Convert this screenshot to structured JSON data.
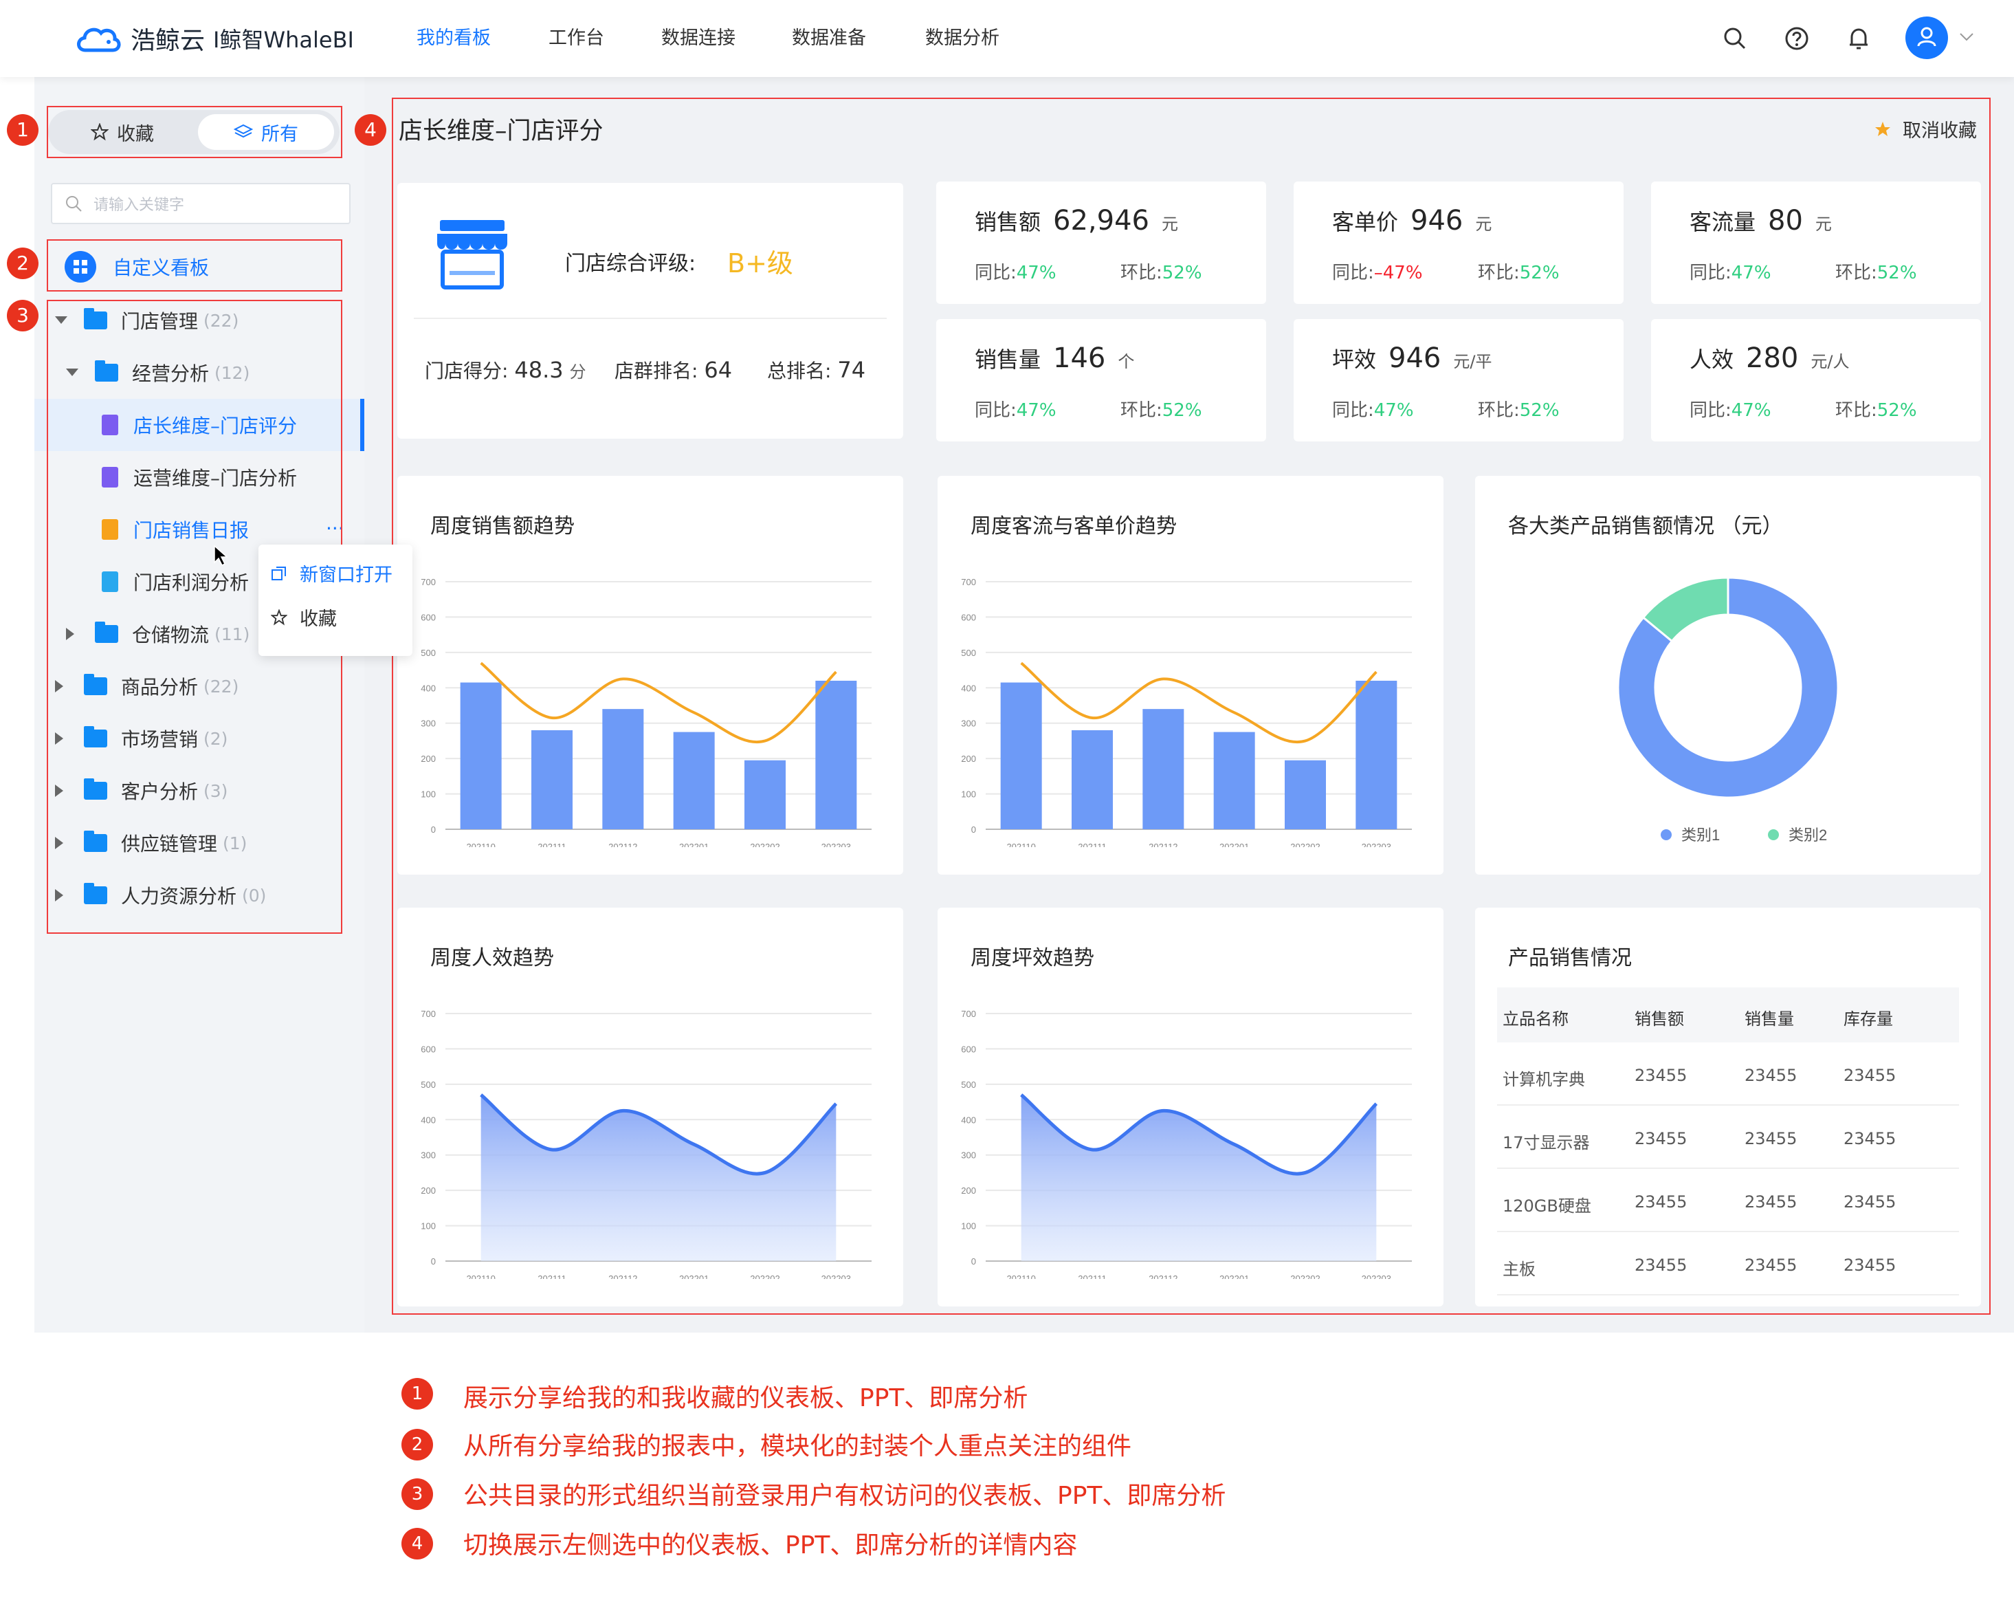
{
  "brand": {
    "name": "浩鲸云",
    "product": "I鲸智WhaleBI"
  },
  "nav": [
    "我的看板",
    "工作台",
    "数据连接",
    "数据准备",
    "数据分析"
  ],
  "sidebar": {
    "tabs": {
      "favorites": "收藏",
      "all": "所有"
    },
    "search_placeholder": "请输入关键字",
    "custom_board": "自定义看板",
    "tree": [
      {
        "label": "门店管理",
        "count": "(22)"
      },
      {
        "label": "经营分析",
        "count": "(12)"
      },
      {
        "label": "店长维度–门店评分"
      },
      {
        "label": "运营维度–门店分析"
      },
      {
        "label": "门店销售日报"
      },
      {
        "label": "门店利润分析"
      },
      {
        "label": "仓储物流",
        "count": "(11)"
      },
      {
        "label": "商品分析",
        "count": "(22)"
      },
      {
        "label": "市场营销",
        "count": "(2)"
      },
      {
        "label": "客户分析",
        "count": "(3)"
      },
      {
        "label": "供应链管理",
        "count": "(1)"
      },
      {
        "label": "人力资源分析",
        "count": "(0)"
      }
    ],
    "more": "···",
    "context_menu": [
      "新窗口打开",
      "收藏"
    ]
  },
  "main": {
    "title": "店长维度–门店评分",
    "unfavorite": "取消收藏",
    "store": {
      "rating_label": "门店综合评级:",
      "rating": "B+级",
      "score_label": "门店得分:",
      "score": "48.3",
      "score_unit": "分",
      "group_rank_label": "店群排名:",
      "group_rank": "64",
      "total_rank_label": "总排名:",
      "total_rank": "74"
    },
    "kpis": [
      {
        "label": "销售额",
        "value": "62,946",
        "unit": "元",
        "yoy_label": "同比:",
        "yoy": "47%",
        "mom_label": "环比:",
        "mom": "52%"
      },
      {
        "label": "客单价",
        "value": "946",
        "unit": "元",
        "yoy_label": "同比:",
        "yoy": "–47%",
        "mom_label": "环比:",
        "mom": "52%"
      },
      {
        "label": "客流量",
        "value": "80",
        "unit": "元",
        "yoy_label": "同比:",
        "yoy": "47%",
        "mom_label": "环比:",
        "mom": "52%"
      },
      {
        "label": "销售量",
        "value": "146",
        "unit": "个",
        "yoy_label": "同比:",
        "yoy": "47%",
        "mom_label": "环比:",
        "mom": "52%"
      },
      {
        "label": "坪效",
        "value": "946",
        "unit": "元/平",
        "yoy_label": "同比:",
        "yoy": "47%",
        "mom_label": "环比:",
        "mom": "52%"
      },
      {
        "label": "人效",
        "value": "280",
        "unit": "元/人",
        "yoy_label": "同比:",
        "yoy": "47%",
        "mom_label": "环比:",
        "mom": "52%"
      }
    ],
    "product_table": {
      "title": "产品销售情况",
      "columns": [
        "立品名称",
        "销售额",
        "销售量",
        "库存量"
      ],
      "rows": [
        [
          "计算机字典",
          "23455",
          "23455",
          "23455"
        ],
        [
          "17寸显示器",
          "23455",
          "23455",
          "23455"
        ],
        [
          "120GB硬盘",
          "23455",
          "23455",
          "23455"
        ],
        [
          "主板",
          "23455",
          "23455",
          "23455"
        ]
      ]
    }
  },
  "annotations": {
    "markers": [
      "1",
      "2",
      "3",
      "4"
    ],
    "notes": [
      "展示分享给我的和我收藏的仪表板、PPT、即席分析",
      "从所有分享给我的报表中，模块化的封装个人重点关注的组件",
      "公共目录的形式组织当前登录用户有权访问的仪表板、PPT、即席分析",
      "切换展示左侧选中的仪表板、PPT、即席分析的详情内容"
    ]
  },
  "colors": {
    "accent": "#1677ff",
    "bar": "#6d9af7",
    "line": "#f5a623",
    "area_line": "#3e76f0",
    "green": "#2fcf80",
    "red": "#f5222d",
    "donut_teal": "#6fdcb0",
    "annotation": "#e8321e"
  },
  "chart_data": [
    {
      "type": "bar",
      "title": "周度销售额趋势",
      "categories": [
        "202110",
        "202111",
        "202112",
        "202201",
        "202202",
        "202203"
      ],
      "series": [
        {
          "values": [
            415,
            280,
            340,
            275,
            195,
            420
          ]
        }
      ],
      "curve": [
        470,
        315,
        425,
        330,
        250,
        445
      ],
      "ylim": [
        0,
        700
      ],
      "yticks": [
        0,
        100,
        200,
        300,
        400,
        500,
        600,
        700
      ]
    },
    {
      "type": "bar",
      "title": "周度客流与客单价趋势",
      "categories": [
        "202110",
        "202111",
        "202112",
        "202201",
        "202202",
        "202203"
      ],
      "series": [
        {
          "values": [
            415,
            280,
            340,
            275,
            195,
            420
          ]
        }
      ],
      "curve": [
        470,
        315,
        425,
        330,
        250,
        445
      ],
      "ylim": [
        0,
        700
      ],
      "yticks": [
        0,
        100,
        200,
        300,
        400,
        500,
        600,
        700
      ]
    },
    {
      "type": "pie",
      "title": "各大类产品销售额情况 （元）",
      "series": [
        {
          "name": "类别1",
          "value": 86
        },
        {
          "name": "类别2",
          "value": 14
        }
      ]
    },
    {
      "type": "area",
      "title": "周度人效趋势",
      "categories": [
        "202110",
        "202111",
        "202112",
        "202201",
        "202202",
        "202203"
      ],
      "curve": [
        470,
        315,
        425,
        330,
        250,
        445
      ],
      "ylim": [
        0,
        700
      ],
      "yticks": [
        0,
        100,
        200,
        300,
        400,
        500,
        600,
        700
      ]
    },
    {
      "type": "area",
      "title": "周度坪效趋势",
      "categories": [
        "202110",
        "202111",
        "202112",
        "202201",
        "202202",
        "202203"
      ],
      "curve": [
        470,
        315,
        425,
        330,
        250,
        445
      ],
      "ylim": [
        0,
        700
      ],
      "yticks": [
        0,
        100,
        200,
        300,
        400,
        500,
        600,
        700
      ]
    }
  ]
}
